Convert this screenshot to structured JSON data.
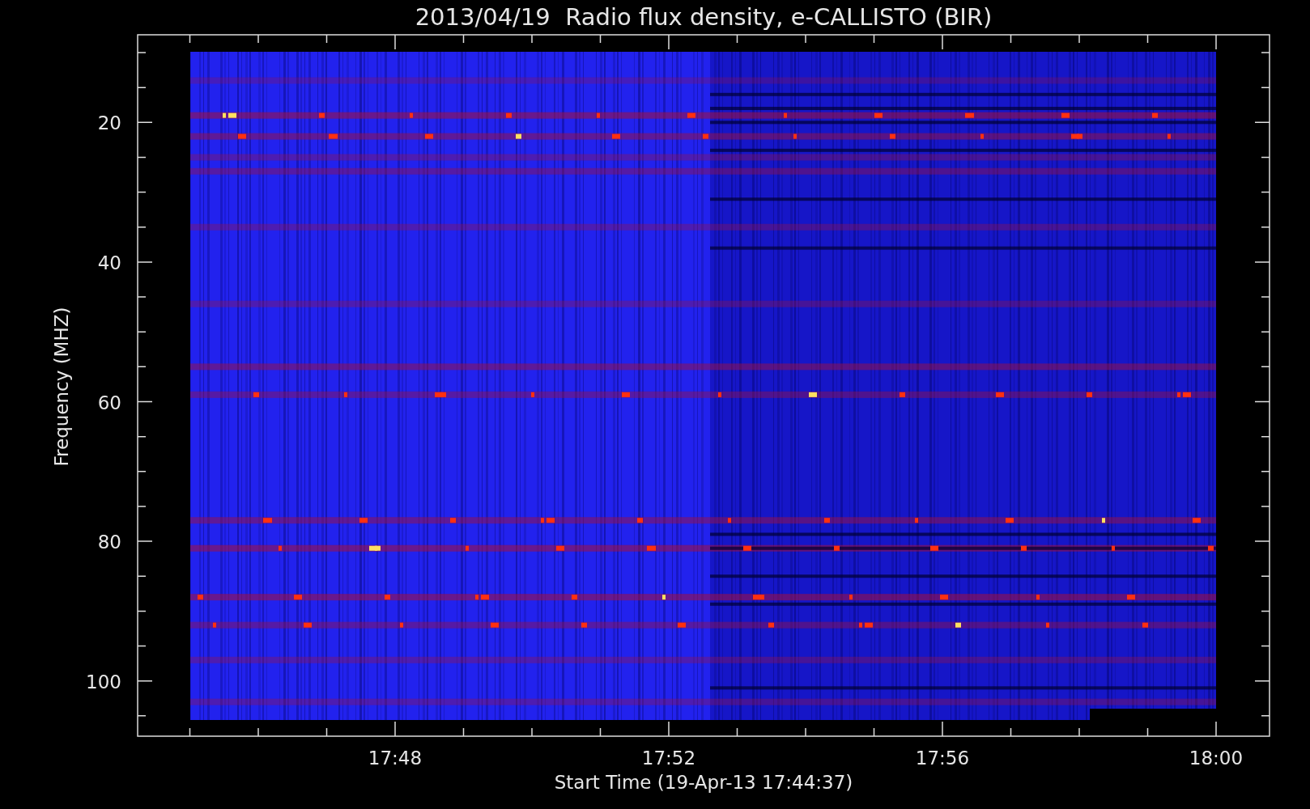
{
  "title": "2013/04/19  Radio flux density, e-CALLISTO (BIR)",
  "plot": {
    "ylabel": "Frequency (MHZ)",
    "xlabel": "Start Time (19-Apr-13 17:44:37)",
    "yticks": [
      "20",
      "40",
      "60",
      "80",
      "100"
    ],
    "xticks": [
      "17:48",
      "17:52",
      "17:56",
      "18:00"
    ]
  }
}
